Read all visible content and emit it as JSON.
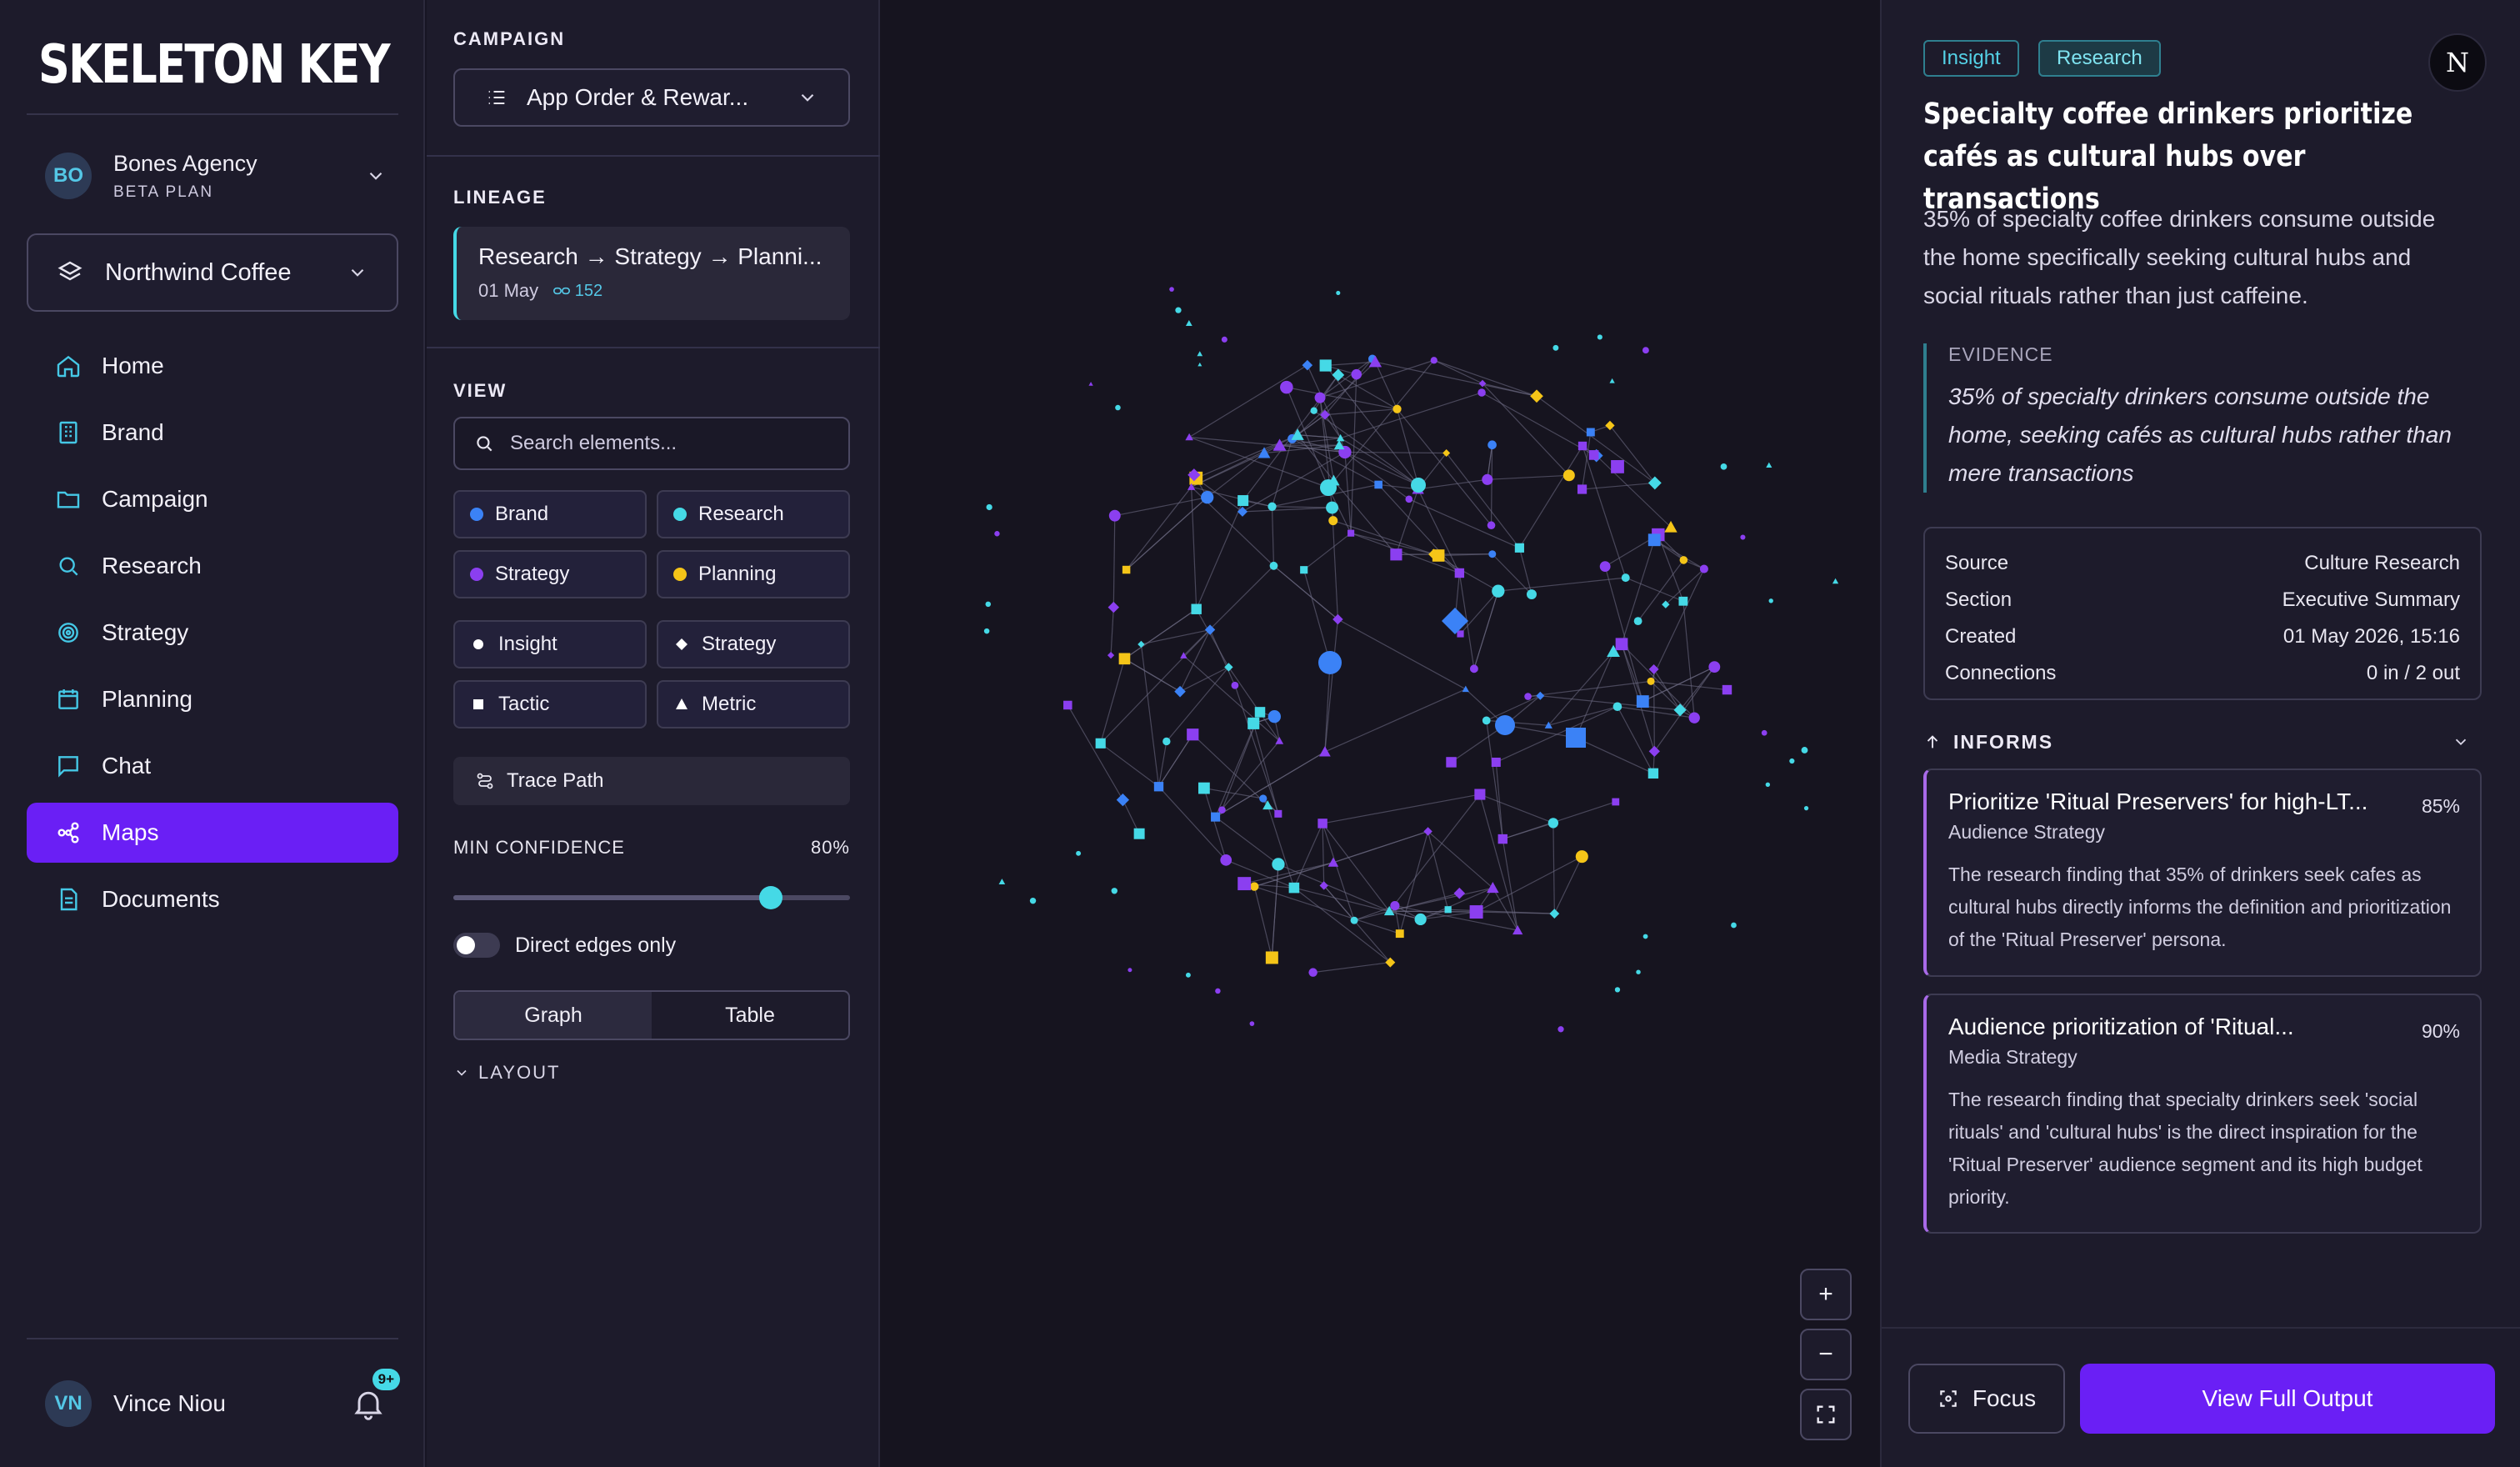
{
  "app": {
    "logo_text": "SKELETON KEY"
  },
  "agency": {
    "initials": "BO",
    "name": "Bones Agency",
    "plan": "BETA PLAN"
  },
  "client": {
    "name": "Northwind Coffee"
  },
  "menu": [
    {
      "label": "Home",
      "icon": "home-icon",
      "active": false
    },
    {
      "label": "Brand",
      "icon": "building-icon",
      "active": false
    },
    {
      "label": "Campaign",
      "icon": "folder-icon",
      "active": false
    },
    {
      "label": "Research",
      "icon": "search-icon",
      "active": false
    },
    {
      "label": "Strategy",
      "icon": "target-icon",
      "active": false
    },
    {
      "label": "Planning",
      "icon": "calendar-icon",
      "active": false
    },
    {
      "label": "Chat",
      "icon": "chat-icon",
      "active": false
    },
    {
      "label": "Maps",
      "icon": "graph-icon",
      "active": true
    },
    {
      "label": "Documents",
      "icon": "document-icon",
      "active": false
    }
  ],
  "user": {
    "initials": "VN",
    "name": "Vince Niou",
    "notifications": "9+"
  },
  "panel": {
    "campaign_label": "CAMPAIGN",
    "campaign_value": "App Order & Rewar...",
    "lineage_label": "LINEAGE",
    "lineage_path": "Research → Strategy → Planni...",
    "lineage_date": "01 May",
    "lineage_links": "152",
    "view_label": "VIEW",
    "search_placeholder": "Search elements...",
    "type_filters": [
      {
        "label": "Brand",
        "color": "#3b82f6"
      },
      {
        "label": "Research",
        "color": "#45d9e6"
      },
      {
        "label": "Strategy",
        "color": "#8b3ff0"
      },
      {
        "label": "Planning",
        "color": "#f5c518"
      }
    ],
    "shape_filters": [
      {
        "label": "Insight",
        "shape": "circle"
      },
      {
        "label": "Strategy",
        "shape": "diamond"
      },
      {
        "label": "Tactic",
        "shape": "square"
      },
      {
        "label": "Metric",
        "shape": "triangle"
      }
    ],
    "trace_label": "Trace Path",
    "confidence_label": "MIN CONFIDENCE",
    "confidence_value": "80%",
    "confidence_fraction": 0.8,
    "direct_label": "Direct edges only",
    "direct_on": false,
    "tab_graph": "Graph",
    "tab_table": "Table",
    "layout_label": "LAYOUT"
  },
  "graph_controls": {
    "zoom_in": "+",
    "zoom_out": "−"
  },
  "detail": {
    "tag_insight": "Insight",
    "tag_research": "Research",
    "corner_avatar": "N",
    "title": "Specialty coffee drinkers prioritize cafés as cultural hubs over transactions",
    "summary": "35% of specialty coffee drinkers consume outside the home specifically seeking cultural hubs and social rituals rather than just caffeine.",
    "evidence_label": "EVIDENCE",
    "evidence_quote": "35% of specialty drinkers consume outside the home, seeking cafés as cultural hubs rather than mere transactions",
    "meta": [
      {
        "key": "Source",
        "value": "Culture Research"
      },
      {
        "key": "Section",
        "value": "Executive Summary"
      },
      {
        "key": "Created",
        "value": "01 May 2026, 15:16"
      },
      {
        "key": "Connections",
        "value": "0 in / 2 out"
      }
    ],
    "informs_label": "INFORMS",
    "informs": [
      {
        "title": "Prioritize 'Ritual Preservers' for high-LT...",
        "percent": "85%",
        "subtitle": "Audience Strategy",
        "description": "The research finding that 35% of drinkers seek cafes as cultural hubs directly informs the definition and prioritization of the 'Ritual Preserver' persona."
      },
      {
        "title": "Audience prioritization of 'Ritual...",
        "percent": "90%",
        "subtitle": "Media Strategy",
        "description": "The research finding that specialty drinkers seek 'social rituals' and 'cultural hubs' is the direct inspiration for the 'Ritual Preserver' audience segment and its high budget priority."
      }
    ],
    "focus_label": "Focus",
    "full_output_label": "View Full Output"
  }
}
